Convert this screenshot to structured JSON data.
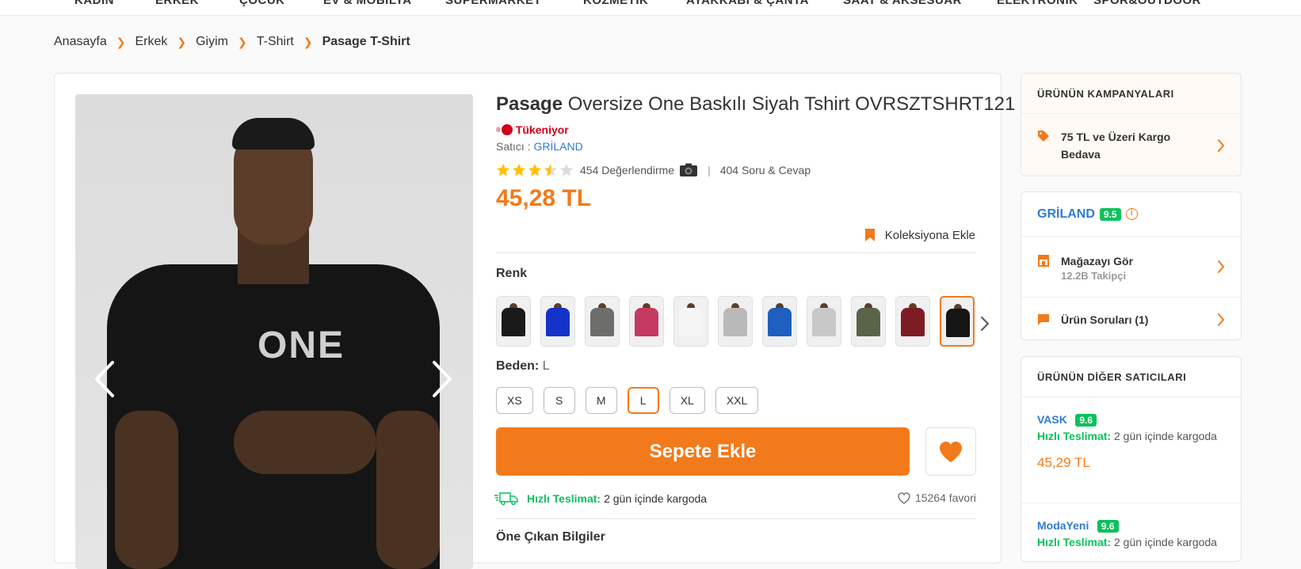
{
  "top_nav": {
    "items": [
      "KADIN",
      "ERKEK",
      "ÇOCUK",
      "EV & MOBİLYA",
      "SÜPERMARKET",
      "KOZMETİK",
      "AYAKKABI & ÇANTA",
      "SAAT & AKSESUAR",
      "ELEKTRONİK",
      "SPOR&OUTDOOR"
    ]
  },
  "breadcrumb": {
    "items": [
      "Anasayfa",
      "Erkek",
      "Giyim",
      "T-Shirt",
      "Pasage T-Shirt"
    ]
  },
  "product": {
    "brand": "Pasage",
    "name": "Oversize One Baskılı Siyah Tshirt OVRSZTSHRT121",
    "stock_label": "Tükeniyor",
    "seller_prefix": "Satıcı :",
    "seller_name": "GRİLAND",
    "rating": 3.5,
    "review_count": "454 Değerlendirme",
    "qa_count": "404 Soru & Cevap",
    "price": "45,28 TL",
    "collection_label": "Koleksiyona Ekle",
    "image_text": "ONE"
  },
  "color_section": {
    "label": "Renk",
    "swatches": [
      {
        "color": "#1a1a1a"
      },
      {
        "color": "#1433c9"
      },
      {
        "color": "#6d6d6b"
      },
      {
        "color": "#c43a62"
      },
      {
        "color": "#f5f5f5"
      },
      {
        "color": "#b9b9b9"
      },
      {
        "color": "#1e5fc0"
      },
      {
        "color": "#c8c8c8"
      },
      {
        "color": "#5a6448"
      },
      {
        "color": "#7e1c24"
      },
      {
        "color": "#151515"
      }
    ]
  },
  "size_section": {
    "label": "Beden:",
    "selected": "L",
    "sizes": [
      "XS",
      "S",
      "M",
      "L",
      "XL",
      "XXL"
    ]
  },
  "actions": {
    "add_to_cart": "Sepete Ekle"
  },
  "delivery": {
    "fast_label": "Hızlı Teslimat:",
    "text": "2 gün içinde kargoda",
    "favorites": "15264 favori"
  },
  "highlights": {
    "title": "Öne Çıkan Bilgiler"
  },
  "campaigns": {
    "title": "ÜRÜNÜN KAMPANYALARI",
    "item": "75 TL ve Üzeri Kargo Bedava"
  },
  "store": {
    "name": "GRİLAND",
    "score": "9.5",
    "visit_label": "Mağazayı Gör",
    "followers": "12.2B Takipçi",
    "questions_label": "Ürün Soruları (1)"
  },
  "other_sellers": {
    "title": "ÜRÜNÜN DİĞER SATICILARI",
    "sellers": [
      {
        "name": "VASK",
        "score": "9.6",
        "fast_label": "Hızlı Teslimat:",
        "delivery": "2 gün içinde kargoda",
        "price": "45,29 TL"
      },
      {
        "name": "ModaYeni",
        "score": "9.6",
        "fast_label": "Hızlı Teslimat:",
        "delivery": "2 gün içinde kargoda",
        "price": ""
      }
    ]
  },
  "colors": {
    "accent": "#f27a1a",
    "link": "#2e7bd6",
    "success": "#0bc15c",
    "danger": "#d0021b"
  }
}
